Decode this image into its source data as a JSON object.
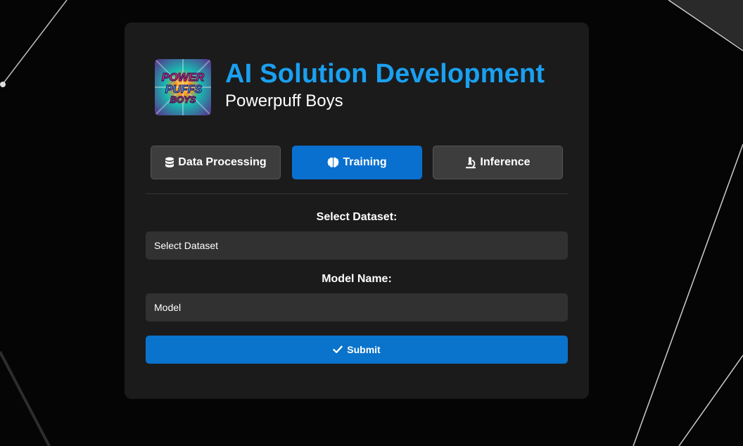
{
  "header": {
    "logo_text": [
      "POWER",
      "PUFFS",
      "BOYS"
    ],
    "title": "AI Solution Development",
    "subtitle": "Powerpuff Boys"
  },
  "tabs": [
    {
      "label": "Data Processing",
      "icon": "database-icon",
      "active": false
    },
    {
      "label": "Training",
      "icon": "brain-icon",
      "active": true
    },
    {
      "label": "Inference",
      "icon": "microscope-icon",
      "active": false
    }
  ],
  "form": {
    "dataset_label": "Select Dataset:",
    "dataset_value": "Select Dataset",
    "model_label": "Model Name:",
    "model_placeholder": "Model",
    "submit_label": "Submit",
    "submit_icon": "check-icon"
  },
  "colors": {
    "accent": "#1aa0f0",
    "active_tab": "#0a70cf",
    "submit": "#0a73cb",
    "card": "#1b1b1c",
    "background": "#050505"
  }
}
